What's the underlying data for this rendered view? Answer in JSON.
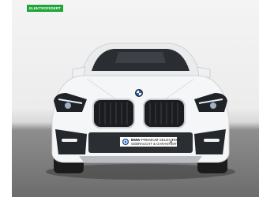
{
  "badge": {
    "label": "ELEKTROFIZIERT"
  },
  "plate": {
    "brand": "BMW",
    "line1": "PREMIUM SELECTION",
    "line2": "GEBRAUCHT & GARANTIERT",
    "check": "✓"
  },
  "colors": {
    "badge_green": "#1fa63a",
    "car_body": "#f5f6f7",
    "floor": "#6c6c6c"
  },
  "icons": [
    "bmw-roundel-icon",
    "checkmark-icon"
  ]
}
